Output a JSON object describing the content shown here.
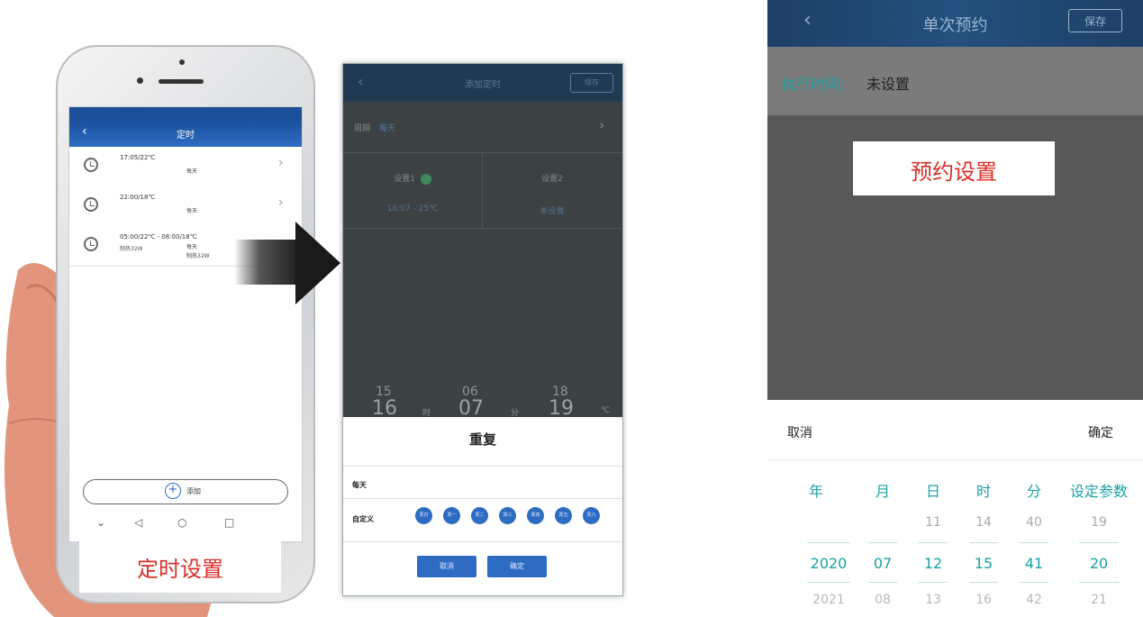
{
  "phone": {
    "title": "定时",
    "items": [
      {
        "time": "17:05/22℃",
        "day": "每天"
      },
      {
        "time": "22:00/18℃",
        "day": "每天"
      },
      {
        "time": "05:00/22℃ - 08:00/18℃",
        "mode": "制热32W",
        "day": "每天",
        "extra": "制热32W"
      }
    ],
    "add_label": "添加",
    "caption": "定时设置"
  },
  "middle": {
    "title": "添加定时",
    "save": "保存",
    "week_key": "周期",
    "week_value": "每天",
    "setting1": "设置1",
    "setting1_value": "16:07 - 25℃",
    "setting2": "设置2",
    "setting2_value": "未设置",
    "wheel": {
      "h_prev": "15",
      "h": "16",
      "h_unit": "时",
      "m_prev": "06",
      "m": "07",
      "m_unit": "分",
      "t_prev": "18",
      "t": "19",
      "t_unit": "℃"
    },
    "sheet_title": "重复",
    "everyday": "每天",
    "custom": "自定义",
    "days": [
      "周日",
      "周一",
      "周二",
      "周三",
      "周四",
      "周五",
      "周六"
    ],
    "cancel": "取消",
    "confirm": "确定"
  },
  "right": {
    "title": "单次预约",
    "save": "保存",
    "exec_label": "执行时间:",
    "exec_value": "未设置",
    "caption": "预约设置",
    "cancel": "取消",
    "confirm": "确定",
    "headers": [
      "年",
      "月",
      "日",
      "时",
      "分",
      "设定参数"
    ],
    "row_prev": [
      "",
      "",
      "11",
      "14",
      "40",
      "19"
    ],
    "row_selected": [
      "2020",
      "07",
      "12",
      "15",
      "41",
      "20"
    ],
    "row_next": [
      "2021",
      "08",
      "13",
      "16",
      "42",
      "21"
    ]
  },
  "colors": {
    "teal": "#1aa1a4",
    "caption_red": "#d9302a",
    "app_blue": "#2d6cc2"
  }
}
